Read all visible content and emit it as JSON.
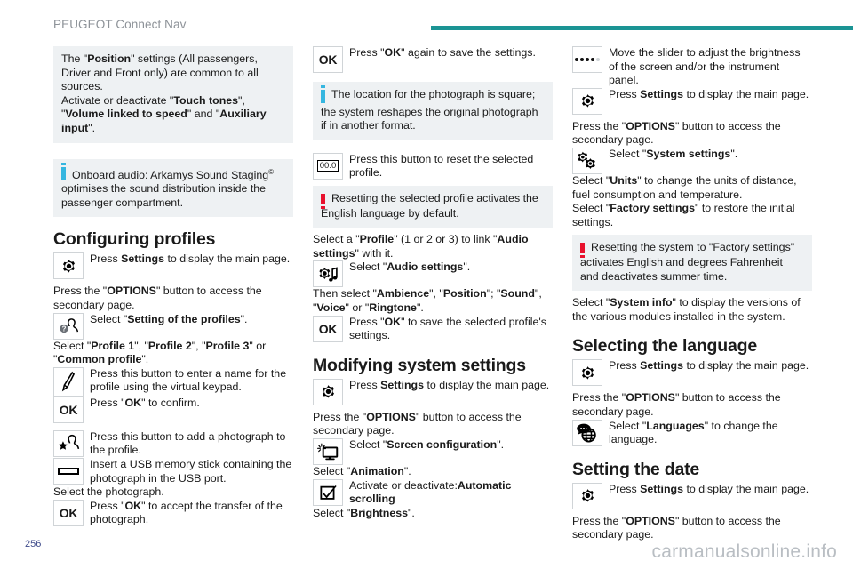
{
  "header": {
    "title": "PEUGEOT Connect Nav",
    "rule_color": "#1b9494"
  },
  "footer": {
    "page_number": "256",
    "watermark": "carmanualsonline.info"
  },
  "colors": {
    "info": "#35b6e0",
    "warning": "#e8112d",
    "note_background": "#eef1f3"
  },
  "column1": {
    "note1": {
      "icon": "none",
      "text_parts": [
        {
          "t": "The \"",
          "b": false
        },
        {
          "t": "Position",
          "b": true
        },
        {
          "t": "\" settings (All passengers, Driver and Front only) are common to all sources.",
          "b": false
        }
      ],
      "line1": "The \"Position\" settings (All passengers,",
      "line2": "Driver and Front only) are common to all",
      "line3": "sources.",
      "line4": "Activate or deactivate \"Touch tones\",",
      "line5": "\"Volume linked to speed\" and \"Auxiliary",
      "line6": "input\"."
    },
    "note2": {
      "icon": "info-icon",
      "text": "Onboard audio: Arkamys Sound Staging optimises the sound distribution inside the passenger compartment."
    },
    "heading": "Configuring profiles",
    "row_settings": {
      "icon": "gear-icon",
      "text": "Press Settings to display the main page."
    },
    "para_options": "Press the \"OPTIONS\" button to access the secondary page.",
    "row_profiles": {
      "icon": "person-question-icon",
      "text": "Select \"Setting of the profiles\"."
    },
    "para_select_profile": "Select \"Profile 1\", \"Profile 2\", \"Profile 3\" or \"Common profile\".",
    "row_pen": {
      "icon": "pen-icon",
      "text": "Press this button to enter a name for the profile using the virtual keypad."
    },
    "row_ok_confirm": {
      "icon": "ok-icon",
      "label": "OK",
      "text": "Press \"OK\" to confirm."
    },
    "row_photo": {
      "icon": "person-star-icon",
      "text": "Press this button to add a photograph to the profile."
    },
    "row_usb": {
      "icon": "usb-stick-icon",
      "text": "Insert a USB memory stick containing the photograph in the USB port."
    },
    "para_select_photo": "Select the photograph.",
    "row_ok_transfer": {
      "icon": "ok-icon",
      "label": "OK",
      "text": "Press \"OK\" to accept the transfer of the photograph."
    }
  },
  "column2": {
    "row_ok_save": {
      "icon": "ok-icon",
      "label": "OK",
      "text": "Press \"OK\" again to save the settings."
    },
    "note_photo": {
      "icon": "info-icon",
      "text": "The location for the photograph is square; the system reshapes the original photograph if in another format."
    },
    "row_reset": {
      "icon": "reset-value-icon",
      "label": "00.0",
      "text": "Press this button to reset the selected profile."
    },
    "note_reset": {
      "icon": "warning-icon",
      "text": "Resetting the selected profile activates the English language by default."
    },
    "para_link_audio": "Select a \"Profile\" (1 or 2 or 3) to link \"Audio settings\" with it.",
    "row_audio": {
      "icon": "audio-settings-icon",
      "text": "Select \"Audio settings\"."
    },
    "para_then_select": "Then select \"Ambience\", \"Position\"; \"Sound\", \"Voice\" or \"Ringtone\".",
    "row_ok_profile": {
      "icon": "ok-icon",
      "label": "OK",
      "text": "Press \"OK\" to save the selected profile's settings."
    },
    "heading": "Modifying system settings",
    "row_settings": {
      "icon": "gear-icon",
      "text": "Press Settings to display the main page."
    },
    "para_options": "Press the \"OPTIONS\" button to access the secondary page.",
    "row_screen": {
      "icon": "screen-configuration-icon",
      "text": "Select \"Screen configuration\"."
    },
    "para_animation": "Select \"Animation\".",
    "row_checkbox": {
      "icon": "checkbox-icon",
      "text": "Activate or deactivate:Automatic scrolling"
    },
    "para_brightness": "Select \"Brightness\"."
  },
  "column3": {
    "row_slider": {
      "icon": "brightness-slider-icon",
      "text": "Move the slider to adjust the brightness of the screen and/or the instrument panel."
    },
    "row_settings": {
      "icon": "gear-icon",
      "text": "Press Settings to display the main page."
    },
    "para_options": "Press the \"OPTIONS\" button to access the secondary page.",
    "row_system": {
      "icon": "double-gear-icon",
      "text": "Select \"System settings\"."
    },
    "para_units": "Select \"Units\" to change the units of distance, fuel consumption and temperature.",
    "para_factory": "Select \"Factory settings\" to restore the initial settings.",
    "note_factory": {
      "icon": "warning-icon",
      "text": "Resetting the system to \"Factory settings\" activates English and degrees Fahrenheit and deactivates summer time."
    },
    "para_system_info": "Select \"System info\" to display the versions of the various modules installed in the system.",
    "heading_language": "Selecting the language",
    "row_settings2": {
      "icon": "gear-icon",
      "text": "Press Settings to display the main page."
    },
    "para_options2": "Press the \"OPTIONS\" button to access the secondary page.",
    "row_languages": {
      "icon": "languages-icon",
      "text": "Select \"Languages\" to change the language."
    },
    "heading_date": "Setting the date",
    "row_settings3": {
      "icon": "gear-icon",
      "text": "Press Settings to display the main page."
    },
    "para_options3": "Press the \"OPTIONS\" button to access the secondary page."
  }
}
